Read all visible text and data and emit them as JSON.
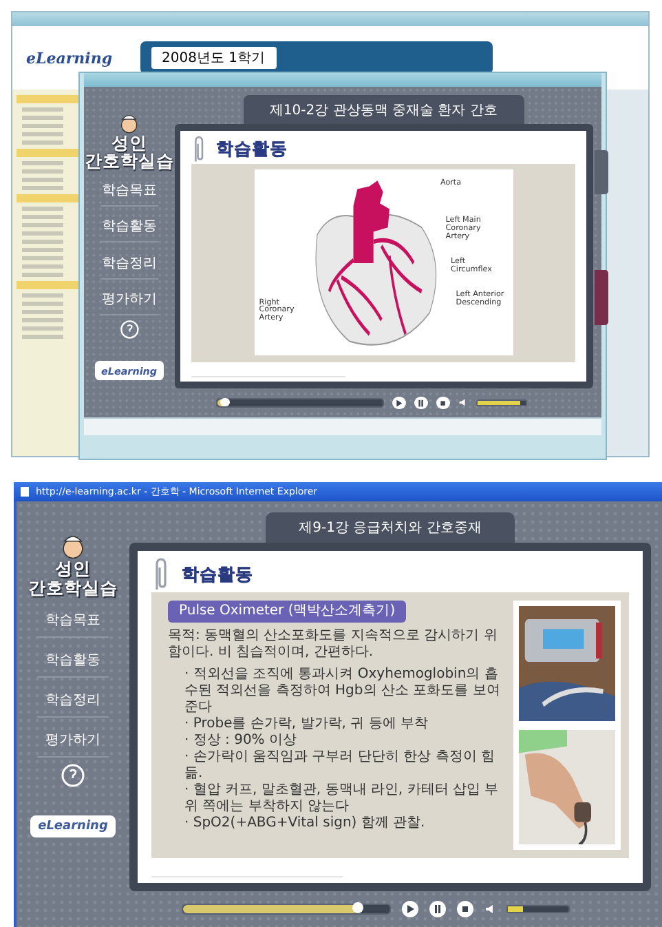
{
  "top_screenshot": {
    "back_window": {
      "logo": "eLearning",
      "term": "2008년도 1학기"
    },
    "player": {
      "logo": [
        "성인",
        "간호학실습"
      ],
      "nav": [
        "학습목표",
        "학습활동",
        "학습정리",
        "평가하기"
      ],
      "partner_logo": "eLearning",
      "lesson_title": "제10-2강 관상동맥 중재술 환자 간호",
      "section_title": "학습활동",
      "content": {
        "kind": "diagram",
        "labels": [
          "Aorta",
          "Left Main Coronary Artery",
          "Left Circumflex",
          "Left Anterior Descending",
          "Right Coronary Artery"
        ]
      },
      "progress": {
        "level": 0.05
      },
      "volume": {
        "level": 0.9
      }
    }
  },
  "bottom_screenshot": {
    "window": {
      "title": "http://e-learning.ac.kr - 간호학 - Microsoft Internet Explorer"
    },
    "player": {
      "logo": [
        "성인",
        "간호학실습"
      ],
      "nav": [
        "학습목표",
        "학습활동",
        "학습정리",
        "평가하기"
      ],
      "partner_logo": "eLearning",
      "lesson_title": "제9-1강 응급처치와 간호중재",
      "section_title": "학습활동",
      "content": {
        "kind": "text",
        "badge": "Pulse Oximeter (맥박산소계측기)",
        "purpose": "목적: 동맥혈의 산소포화도를 지속적으로 감시하기 위함이다. 비 침습적이며, 간편하다.",
        "bullets": [
          "· 적외선을 조직에 통과시켜 Oxyhemoglobin의 흡수된 적외선을 측정하여 Hgb의 산소 포화도를 보여준다",
          "· Probe를 손가락, 발가락, 귀 등에 부착",
          "· 정상 : 90% 이상",
          "· 손가락이 움직임과 구부러 단단히 한상 측정이 힘듦.",
          "· 혈압 커프, 말초혈관, 동맥내 라인, 카테터 삽입 부위 쪽에는 부착하지 않는다",
          "· SpO2(+ABG+Vital sign) 함께 관찰."
        ]
      },
      "progress": {
        "level": 0.85
      },
      "volume": {
        "level": 0.25
      }
    }
  }
}
